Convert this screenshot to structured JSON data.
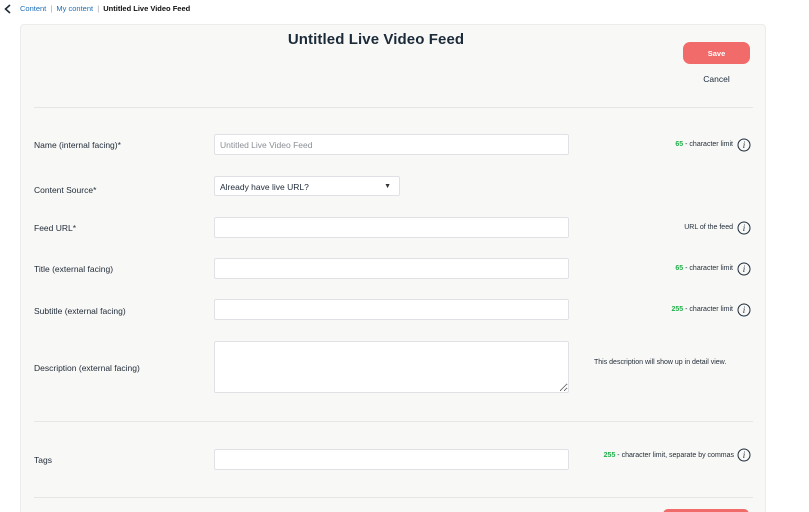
{
  "breadcrumb": {
    "items": [
      "Content",
      "My content"
    ],
    "separator": "|",
    "current": "Untitled Live Video Feed"
  },
  "header": {
    "title": "Untitled Live Video Feed",
    "save_label": "Save",
    "cancel_label": "Cancel"
  },
  "form": {
    "name": {
      "label": "Name (internal facing)*",
      "placeholder": "Untitled Live Video Feed",
      "value": "",
      "limit": "65",
      "hint_suffix": "- character limit"
    },
    "content_source": {
      "label": "Content Source*",
      "selected": "Already have live URL?"
    },
    "feed_url": {
      "label": "Feed URL*",
      "value": "",
      "hint": "URL of the feed"
    },
    "title": {
      "label": "Title (external facing)",
      "value": "",
      "limit": "65",
      "hint_suffix": "- character limit"
    },
    "subtitle": {
      "label": "Subtitle (external facing)",
      "value": "",
      "limit": "255",
      "hint_suffix": "- character limit"
    },
    "description": {
      "label": "Description (external facing)",
      "value": "",
      "hint": "This description will show up in detail view."
    },
    "tags": {
      "label": "Tags",
      "value": "",
      "limit": "255",
      "hint_suffix": "- character limit, separate by commas"
    }
  },
  "colors": {
    "accent": "#f26b6b",
    "limit_number": "#22b04b",
    "title_text": "#1c2b3a",
    "card_background": "#f8f8f6"
  },
  "icons": {
    "back": "chevron-left-icon",
    "info": "info-icon",
    "dropdown": "triangle-down-icon"
  }
}
